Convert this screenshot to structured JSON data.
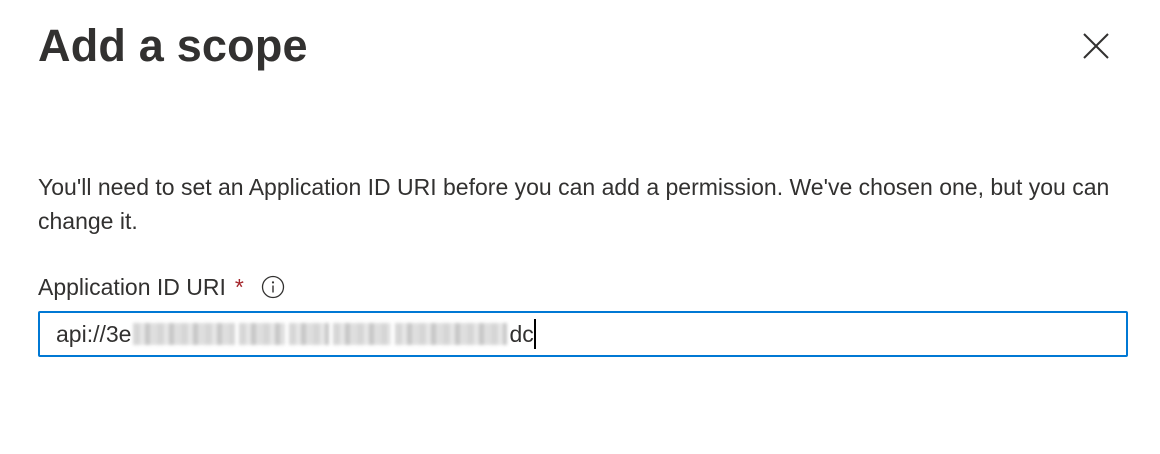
{
  "panel": {
    "title": "Add a scope",
    "close_icon": "close-icon"
  },
  "description": "You'll need to set an Application ID URI before you can add a permission. We've chosen one, but you can change it.",
  "field": {
    "label": "Application ID URI",
    "required_marker": "*",
    "info_icon": "info-icon",
    "value_prefix": "api://3e",
    "value_suffix": "dc"
  },
  "colors": {
    "input_border_focus": "#0078d4",
    "required": "#a4262c",
    "text": "#323130"
  }
}
